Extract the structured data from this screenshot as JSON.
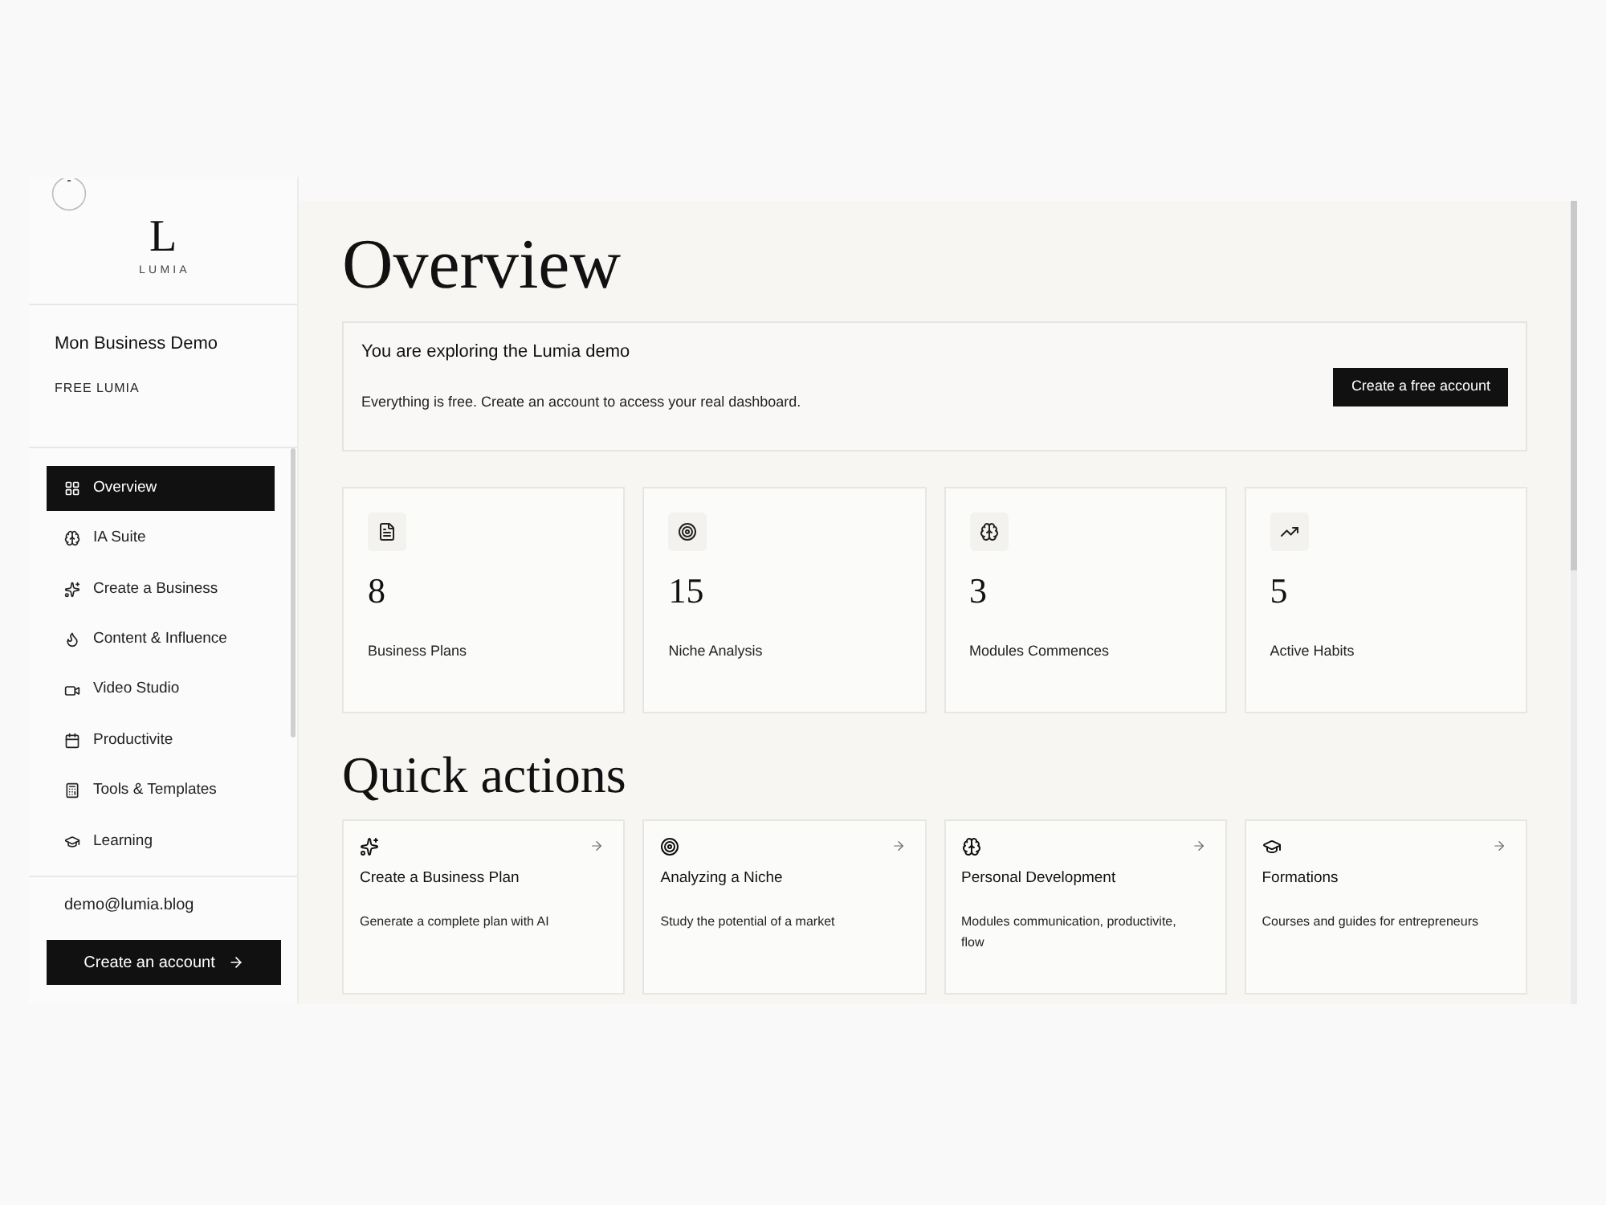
{
  "sidebar": {
    "logo": {
      "letter": "L",
      "name": "LUMIA"
    },
    "workspace": {
      "name": "Mon Business Demo",
      "plan": "FREE LUMIA"
    },
    "nav_items": [
      {
        "label": "Overview",
        "selected": true
      },
      {
        "label": "IA Suite",
        "selected": false
      },
      {
        "label": "Create a Business",
        "selected": false
      },
      {
        "label": "Content & Influence",
        "selected": false
      },
      {
        "label": "Video Studio",
        "selected": false
      },
      {
        "label": "Productivite",
        "selected": false
      },
      {
        "label": "Tools & Templates",
        "selected": false
      },
      {
        "label": "Learning",
        "selected": false
      }
    ],
    "account": {
      "email": "demo@lumia.blog",
      "button": "Create an account"
    }
  },
  "main": {
    "title": "Overview",
    "banner": {
      "title": "You are exploring the Lumia demo",
      "text": "Everything is free. Create an account to access your real dashboard.",
      "button": "Create a free account"
    },
    "stats": [
      {
        "value": "8",
        "label": "Business Plans"
      },
      {
        "value": "15",
        "label": "Niche Analysis"
      },
      {
        "value": "3",
        "label": "Modules Commences"
      },
      {
        "value": "5",
        "label": "Active Habits"
      }
    ],
    "quick_actions_title": "Quick actions",
    "quick_actions": [
      {
        "title": "Create a Business Plan",
        "description": "Generate a complete plan with AI"
      },
      {
        "title": "Analyzing a Niche",
        "description": "Study the potential of a market"
      },
      {
        "title": "Personal Development",
        "description": "Modules communication, productivite, flow"
      },
      {
        "title": "Formations",
        "description": "Courses and guides for entrepreneurs"
      }
    ]
  }
}
